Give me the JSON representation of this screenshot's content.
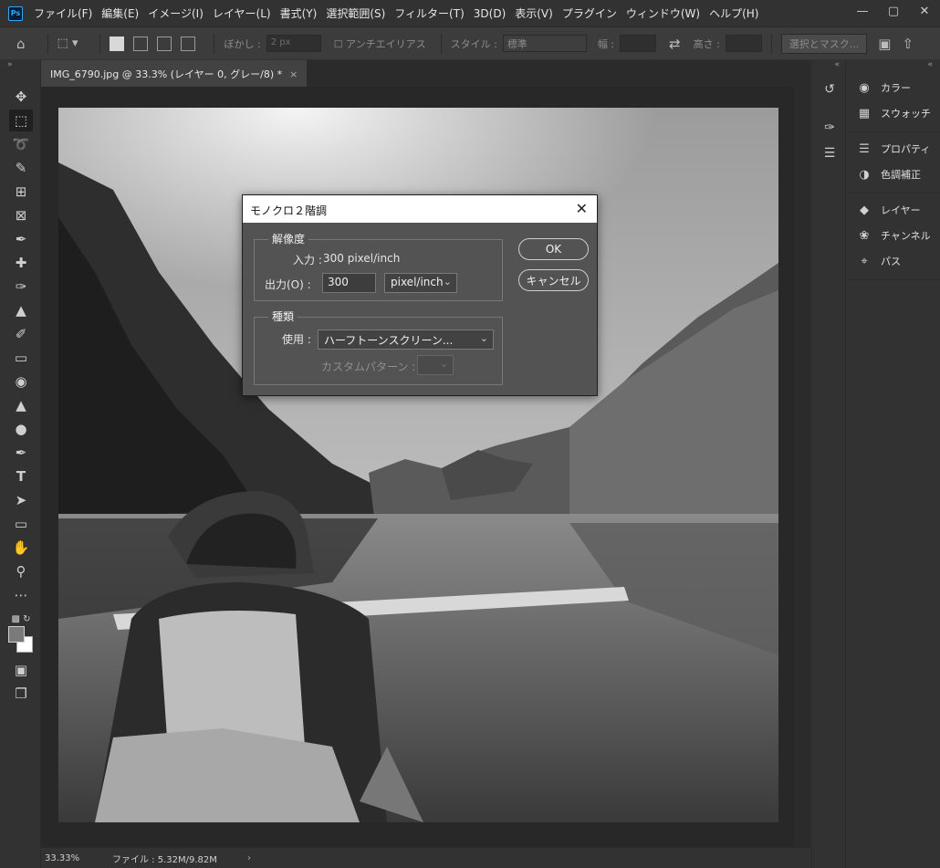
{
  "app": {
    "logo": "Ps",
    "menus": [
      "ファイル(F)",
      "編集(E)",
      "イメージ(I)",
      "レイヤー(L)",
      "書式(Y)",
      "選択範囲(S)",
      "フィルター(T)",
      "3D(D)",
      "表示(V)",
      "プラグイン",
      "ウィンドウ(W)",
      "ヘルプ(H)"
    ]
  },
  "options_bar": {
    "feather_label": "ぼかし :",
    "feather_value": "2 px",
    "antialias_label": "アンチエイリアス",
    "style_label": "スタイル :",
    "style_value": "標準",
    "width_label": "幅 :",
    "height_label": "高さ :",
    "select_mask_label": "選択とマスク..."
  },
  "document": {
    "tab_title": "IMG_6790.jpg @ 33.3% (レイヤー 0, グレー/8) *",
    "close": "×"
  },
  "status": {
    "zoom": "33.33%",
    "file_info": "ファイル : 5.32M/9.82M",
    "arrow": "›"
  },
  "panels": {
    "group1": [
      {
        "icon": "palette-icon",
        "label": "カラー"
      },
      {
        "icon": "grid-icon",
        "label": "スウォッチ"
      }
    ],
    "group2": [
      {
        "icon": "sliders-icon",
        "label": "プロパティ"
      },
      {
        "icon": "half-circle-icon",
        "label": "色調補正"
      }
    ],
    "group3": [
      {
        "icon": "layers-icon",
        "label": "レイヤー"
      },
      {
        "icon": "channels-icon",
        "label": "チャンネル"
      },
      {
        "icon": "path-icon",
        "label": "パス"
      }
    ]
  },
  "dialog": {
    "title": "モノクロ２階調",
    "resolution_legend": "解像度",
    "input_label": "入力 :",
    "input_value": "300 pixel/inch",
    "output_label": "出力(O) :",
    "output_value": "300",
    "output_unit": "pixel/inch",
    "type_legend": "種類",
    "use_label": "使用 :",
    "use_value": "ハーフトーンスクリーン...",
    "custom_pattern_label": "カスタムパターン :",
    "ok_label": "OK",
    "cancel_label": "キャンセル"
  }
}
